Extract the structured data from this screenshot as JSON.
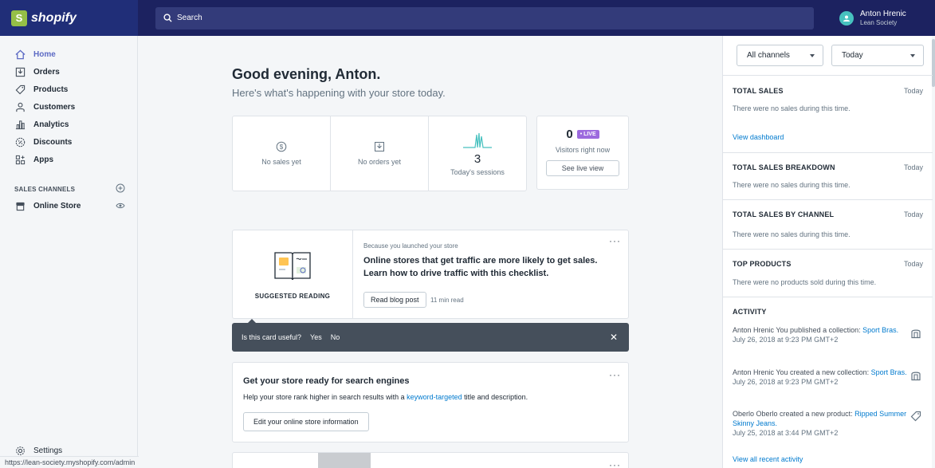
{
  "brand": {
    "logo_text": "shopify",
    "logo_letter": "S"
  },
  "search": {
    "placeholder": "Search"
  },
  "user": {
    "name": "Anton Hrenic",
    "shop": "Lean Society"
  },
  "sidebar": {
    "items": [
      {
        "label": "Home",
        "icon": "home-icon",
        "active": true
      },
      {
        "label": "Orders",
        "icon": "orders-icon"
      },
      {
        "label": "Products",
        "icon": "tag-icon"
      },
      {
        "label": "Customers",
        "icon": "customers-icon"
      },
      {
        "label": "Analytics",
        "icon": "analytics-icon"
      },
      {
        "label": "Discounts",
        "icon": "discount-icon"
      },
      {
        "label": "Apps",
        "icon": "apps-icon"
      }
    ],
    "sales_channels_title": "SALES CHANNELS",
    "online_store_label": "Online Store",
    "settings_label": "Settings",
    "status_url": "https://lean-society.myshopify.com/admin"
  },
  "main": {
    "greeting": "Good evening, Anton.",
    "subtitle": "Here's what's happening with your store today.",
    "stats": {
      "sales_label": "No sales yet",
      "orders_label": "No orders yet",
      "sessions_value": "3",
      "sessions_label": "Today's sessions"
    },
    "live": {
      "visitors": "0",
      "badge": "• LIVE",
      "label": "Visitors right now",
      "button": "See live view"
    },
    "reading": {
      "title": "SUGGESTED READING",
      "meta": "Because you launched your store",
      "headline": "Online stores that get traffic are more likely to get sales. Learn how to drive traffic with this checklist.",
      "button": "Read blog post",
      "time": "11 min read",
      "more": "···"
    },
    "feedback": {
      "question": "Is this card useful?",
      "yes": "Yes",
      "no": "No",
      "close": "✕"
    },
    "seo": {
      "title": "Get your store ready for search engines",
      "desc_before": "Help your store rank higher in search results with a ",
      "desc_link": "keyword-targeted",
      "desc_after": " title and description.",
      "button": "Edit your online store information",
      "more": "···"
    },
    "next_more": "···"
  },
  "right": {
    "channel_select": "All channels",
    "date_select": "Today",
    "sections": [
      {
        "title": "TOTAL SALES",
        "period": "Today",
        "text": "There were no sales during this time."
      },
      {
        "title": "TOTAL SALES BREAKDOWN",
        "period": "Today",
        "text": "There were no sales during this time."
      },
      {
        "title": "TOTAL SALES BY CHANNEL",
        "period": "Today",
        "text": "There were no sales during this time."
      },
      {
        "title": "TOP PRODUCTS",
        "period": "Today",
        "text": "There were no products sold during this time."
      }
    ],
    "view_dashboard": "View dashboard",
    "activity_title": "ACTIVITY",
    "activities": [
      {
        "text": "Anton Hrenic You published a collection: ",
        "link": "Sport Bras.",
        "date": "July 26, 2018 at 9:23 PM GMT+2",
        "icon": "collection-icon"
      },
      {
        "text": "Anton Hrenic You created a new collection: ",
        "link": "Sport Bras.",
        "date": "July 26, 2018 at 9:23 PM GMT+2",
        "icon": "collection-icon"
      },
      {
        "text": "Oberlo Oberlo created a new product: ",
        "link": "Ripped Summer Skinny Jeans.",
        "date": "July 25, 2018 at 3:44 PM GMT+2",
        "icon": "tag-icon"
      }
    ],
    "view_all_activity": "View all recent activity"
  }
}
